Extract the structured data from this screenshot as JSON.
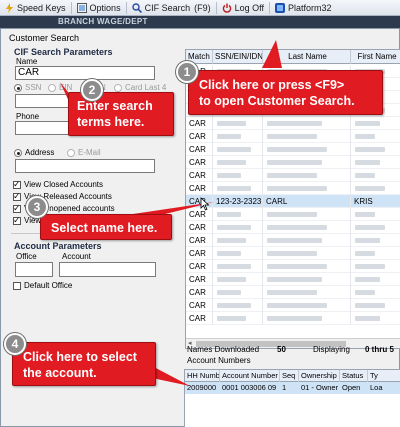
{
  "toolbar": {
    "speed_keys": "Speed Keys",
    "options": "Options",
    "cif_search": "CIF Search",
    "cif_key": "(F9)",
    "log_off": "Log Off",
    "platform": "Platform32"
  },
  "strip_text": "BRANCH WAGE/DEPT",
  "window": {
    "title": "Customer Search"
  },
  "search": {
    "group_title": "CIF Search Parameters",
    "name_label": "Name",
    "name_value": "CAR",
    "id_types": [
      "SSN",
      "EIN",
      "IDN",
      "Card Last 4"
    ],
    "phone_label": "Phone",
    "contact_options": [
      "Address",
      "E-Mail"
    ],
    "checkboxes": [
      {
        "label": "View Closed Accounts",
        "checked": true
      },
      {
        "label": "View Released Accounts",
        "checked": true
      },
      {
        "label": "View Unopened accounts",
        "checked": true
      },
      {
        "label": "View",
        "checked": true
      }
    ],
    "account_group_title": "Account Parameters",
    "office_label": "Office",
    "account_label": "Account",
    "default_office_label": "Default Office"
  },
  "results": {
    "columns": [
      "Match",
      "SSN/EIN/IDN",
      "Last Name",
      "First Name"
    ],
    "rows": [
      {
        "match": "CAR",
        "ssn": "",
        "last": "",
        "first": ""
      },
      {
        "match": "CAR",
        "ssn": "",
        "last": "",
        "first": ""
      },
      {
        "match": "CAR",
        "ssn": "",
        "last": "",
        "first": ""
      },
      {
        "match": "CAR",
        "ssn": "",
        "last": "",
        "first": ""
      },
      {
        "match": "CAR",
        "ssn": "",
        "last": "",
        "first": ""
      },
      {
        "match": "CAR",
        "ssn": "",
        "last": "",
        "first": ""
      },
      {
        "match": "CAR",
        "ssn": "",
        "last": "",
        "first": ""
      },
      {
        "match": "CAR",
        "ssn": "",
        "last": "",
        "first": ""
      },
      {
        "match": "CAR",
        "ssn": "",
        "last": "",
        "first": ""
      },
      {
        "match": "CAR",
        "ssn": "",
        "last": "",
        "first": ""
      },
      {
        "match": "CAR",
        "ssn": "123-23-2323",
        "last": "CARL",
        "first": "KRIS"
      },
      {
        "match": "CAR",
        "ssn": "",
        "last": "",
        "first": ""
      },
      {
        "match": "CAR",
        "ssn": "",
        "last": "",
        "first": ""
      },
      {
        "match": "CAR",
        "ssn": "",
        "last": "",
        "first": ""
      },
      {
        "match": "CAR",
        "ssn": "",
        "last": "",
        "first": ""
      },
      {
        "match": "CAR",
        "ssn": "",
        "last": "",
        "first": ""
      },
      {
        "match": "CAR",
        "ssn": "",
        "last": "",
        "first": ""
      },
      {
        "match": "CAR",
        "ssn": "",
        "last": "",
        "first": ""
      },
      {
        "match": "CAR",
        "ssn": "",
        "last": "",
        "first": ""
      },
      {
        "match": "CAR",
        "ssn": "",
        "last": "",
        "first": ""
      }
    ],
    "selected_index": 10
  },
  "status": {
    "names_downloaded_label": "Names Downloaded",
    "names_downloaded_value": "50",
    "displaying_label": "Displaying",
    "displaying_value": "0 thru 5",
    "account_numbers_label": "Account Numbers"
  },
  "accounts": {
    "columns": [
      "HH Number",
      "Account Number",
      "Seq",
      "Ownership",
      "Status",
      "Ty"
    ],
    "rows": [
      {
        "hh": "2009000",
        "account": "0001 003006 09",
        "seq": "1",
        "ownership": "01 - Owner",
        "status": "Open",
        "type": "Loa"
      }
    ]
  },
  "callouts": [
    {
      "number": "1",
      "lines": [
        "Click here or press <F9>",
        "to open Customer Search."
      ]
    },
    {
      "number": "2",
      "lines": [
        "Enter search",
        "terms here."
      ]
    },
    {
      "number": "3",
      "lines": [
        "Select name here."
      ]
    },
    {
      "number": "4",
      "lines": [
        "Click here to select",
        "the account."
      ]
    }
  ],
  "colors": {
    "callout_red": "#e11b22",
    "selection_blue": "#cfe3f7",
    "toolbar_bg": "#dfe4ec"
  }
}
